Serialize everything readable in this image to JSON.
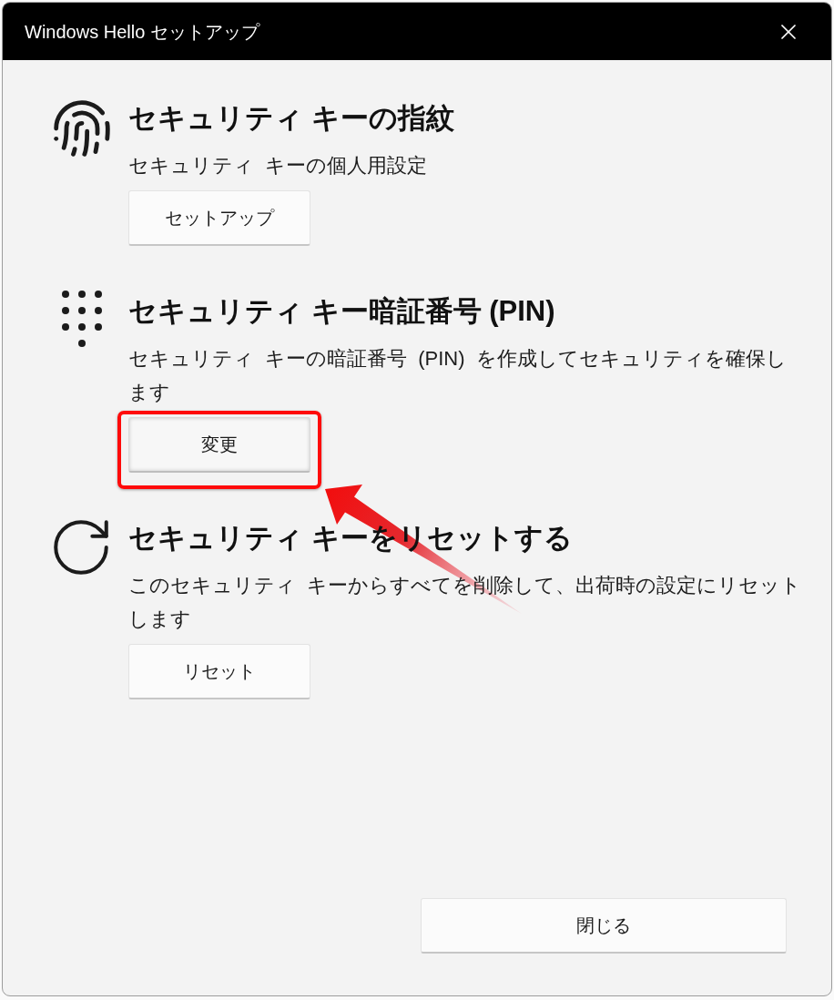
{
  "window": {
    "title": "Windows Hello セットアップ"
  },
  "sections": [
    {
      "kind": "fingerprint",
      "title": "セキュリティ キーの指紋",
      "description": "セキュリティ キーの個人用設定",
      "button": {
        "label": "セットアップ",
        "highlighted": false
      }
    },
    {
      "kind": "pin",
      "title": "セキュリティ キー暗証番号 (PIN)",
      "description": "セキュリティ キーの暗証番号 (PIN) を作成してセキュリティを確保します",
      "button": {
        "label": "変更",
        "highlighted": true
      }
    },
    {
      "kind": "reset",
      "title": "セキュリティ キーをリセットする",
      "description": "このセキュリティ キーからすべてを削除して、出荷時の設定にリセットします",
      "button": {
        "label": "リセット",
        "highlighted": false
      }
    }
  ],
  "footer": {
    "close_button": "閉じる"
  }
}
